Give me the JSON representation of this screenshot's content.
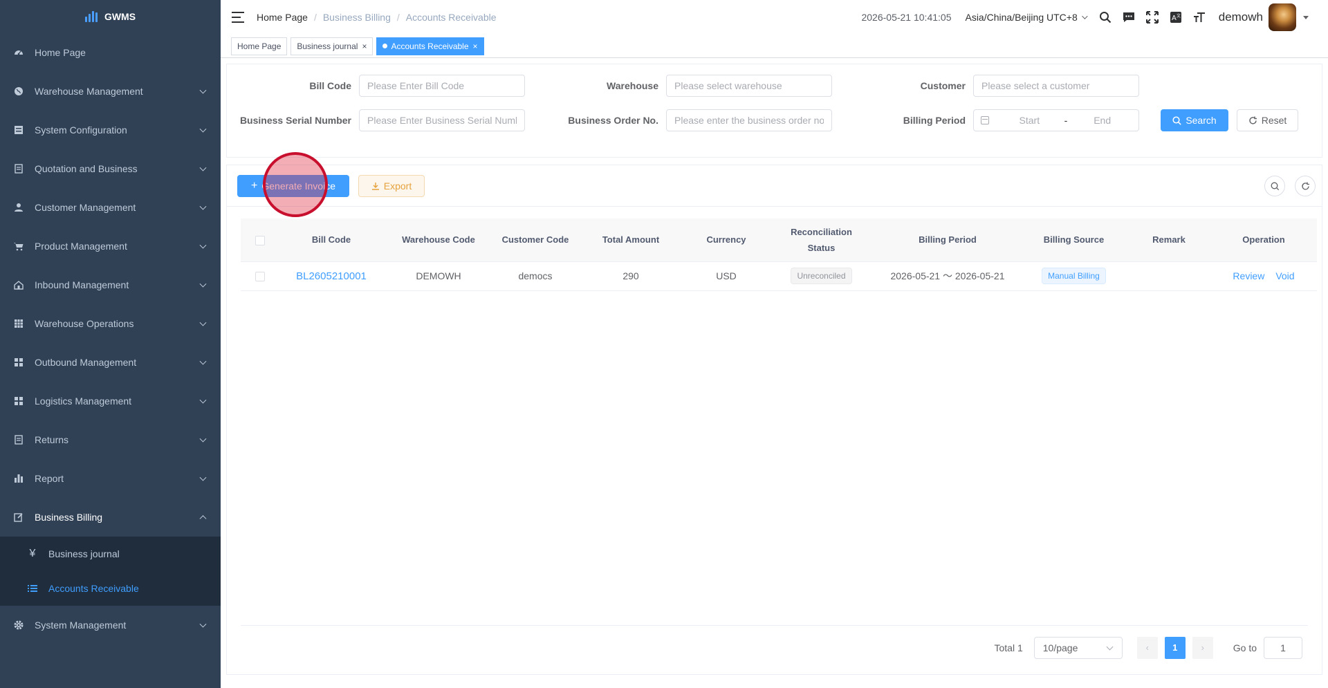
{
  "sidebar": {
    "logo_text": "GWMS",
    "items": [
      {
        "label": "Home Page",
        "icon": "dashboard-icon"
      },
      {
        "label": "Warehouse Management",
        "icon": "globe-icon"
      },
      {
        "label": "System Configuration",
        "icon": "server-icon"
      },
      {
        "label": "Quotation and Business",
        "icon": "document-icon"
      },
      {
        "label": "Customer Management",
        "icon": "user-icon"
      },
      {
        "label": "Product Management",
        "icon": "cart-icon"
      },
      {
        "label": "Inbound Management",
        "icon": "home-icon"
      },
      {
        "label": "Warehouse Operations",
        "icon": "table-icon"
      },
      {
        "label": "Outbound Management",
        "icon": "grid-icon"
      },
      {
        "label": "Logistics Management",
        "icon": "grid-icon"
      },
      {
        "label": "Returns",
        "icon": "document-icon"
      },
      {
        "label": "Report",
        "icon": "bar-chart-icon"
      },
      {
        "label": "Business Billing",
        "icon": "edit-icon"
      },
      {
        "label": "System Management",
        "icon": "gear-icon"
      }
    ],
    "billing_sub": [
      {
        "label": "Business journal",
        "icon": "yen-icon"
      },
      {
        "label": "Accounts Receivable",
        "icon": "list-icon"
      }
    ]
  },
  "navbar": {
    "breadcrumb": [
      "Home Page",
      "Business Billing",
      "Accounts Receivable"
    ],
    "datetime": "2026-05-21 10:41:05",
    "timezone": "Asia/China/Beijing UTC+8",
    "username": "demowh"
  },
  "tags": [
    {
      "label": "Home Page",
      "closable": false
    },
    {
      "label": "Business journal",
      "closable": true
    },
    {
      "label": "Accounts Receivable",
      "closable": true,
      "active": true
    }
  ],
  "filters": {
    "bill_code": {
      "label": "Bill Code",
      "placeholder": "Please Enter Bill Code"
    },
    "warehouse": {
      "label": "Warehouse",
      "placeholder": "Please select warehouse"
    },
    "customer": {
      "label": "Customer",
      "placeholder": "Please select a customer"
    },
    "serial": {
      "label": "Business Serial Number",
      "placeholder": "Please Enter Business Serial Number"
    },
    "order_no": {
      "label": "Business Order No.",
      "placeholder": "Please enter the business order no."
    },
    "billing_period": {
      "label": "Billing Period",
      "start": "Start",
      "sep": "-",
      "end": "End"
    },
    "search_label": "Search",
    "reset_label": "Reset"
  },
  "toolbar": {
    "generate_label": "Generate Invoice",
    "export_label": "Export"
  },
  "table": {
    "columns": [
      "Bill Code",
      "Warehouse Code",
      "Customer Code",
      "Total Amount",
      "Currency",
      "Reconciliation Status",
      "Billing Period",
      "Billing Source",
      "Remark",
      "Operation"
    ],
    "rows": [
      {
        "bill_code": "BL2605210001",
        "warehouse_code": "DEMOWH",
        "customer_code": "democs",
        "total_amount": "290",
        "currency": "USD",
        "status": "Unreconciled",
        "period": "2026-05-21 ～ 2026-05-21",
        "source": "Manual Billing",
        "remark": "",
        "ops": [
          "Review",
          "Void"
        ]
      }
    ]
  },
  "pager": {
    "total": "Total 1",
    "page_size": "10/page",
    "current": "1",
    "goto_label": "Go to",
    "goto_value": "1"
  },
  "colors": {
    "primary": "#409eff",
    "sidebar_bg": "#304156",
    "warning": "#e6a23c"
  }
}
